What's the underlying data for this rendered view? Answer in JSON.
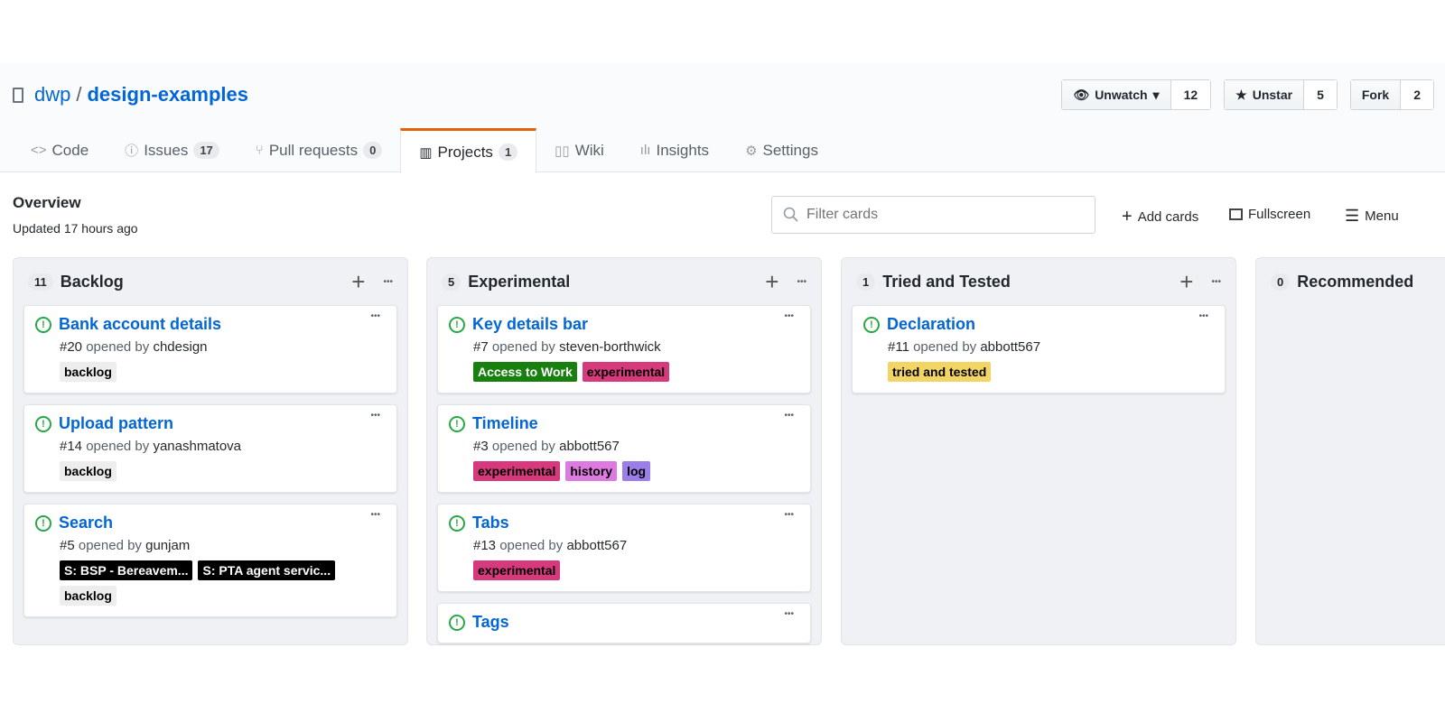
{
  "repo": {
    "owner": "dwp",
    "separator": "/",
    "name": "design-examples"
  },
  "actions": [
    {
      "label": "Unwatch",
      "icon": "eye-icon",
      "caret": true,
      "count": "12"
    },
    {
      "label": "Unstar",
      "icon": "star-icon",
      "count": "5"
    },
    {
      "label": "Fork",
      "count": "2"
    }
  ],
  "tabs": [
    {
      "label": "Code",
      "icon": "code-icon"
    },
    {
      "label": "Issues",
      "icon": "issue-icon",
      "count": "17"
    },
    {
      "label": "Pull requests",
      "icon": "pull-request-icon",
      "count": "0"
    },
    {
      "label": "Projects",
      "icon": "project-icon",
      "count": "1",
      "selected": true
    },
    {
      "label": "Wiki",
      "icon": "book-icon"
    },
    {
      "label": "Insights",
      "icon": "graph-icon"
    },
    {
      "label": "Settings",
      "icon": "gear-icon"
    }
  ],
  "project": {
    "title": "Overview",
    "updated": "Updated 17 hours ago"
  },
  "filter": {
    "placeholder": "Filter cards"
  },
  "toolbar": {
    "add_cards": "Add cards",
    "fullscreen": "Fullscreen",
    "menu": "Menu"
  },
  "colors": {
    "accent": "#e36209",
    "link": "#0366d6",
    "issue_open": "#28a745"
  },
  "columns": [
    {
      "title": "Backlog",
      "count": "11",
      "cards": [
        {
          "title": "Bank account details",
          "number": "#20",
          "opened": "opened by",
          "author": "chdesign",
          "labels": [
            {
              "name": "backlog",
              "bg": "#ededed",
              "fg": "#000"
            }
          ]
        },
        {
          "title": "Upload pattern",
          "number": "#14",
          "opened": "opened by",
          "author": "yanashmatova",
          "labels": [
            {
              "name": "backlog",
              "bg": "#ededed",
              "fg": "#000"
            }
          ]
        },
        {
          "title": "Search",
          "number": "#5",
          "opened": "opened by",
          "author": "gunjam",
          "labels": [
            {
              "name": "S: BSP - Bereavem...",
              "bg": "#000000",
              "fg": "#fff"
            },
            {
              "name": "S: PTA agent servic...",
              "bg": "#000000",
              "fg": "#fff"
            },
            {
              "name": "backlog",
              "bg": "#ededed",
              "fg": "#000"
            }
          ]
        }
      ]
    },
    {
      "title": "Experimental",
      "count": "5",
      "cards": [
        {
          "title": "Key details bar",
          "number": "#7",
          "opened": "opened by",
          "author": "steven-borthwick",
          "labels": [
            {
              "name": "Access to Work",
              "bg": "#18800f",
              "fg": "#fff"
            },
            {
              "name": "experimental",
              "bg": "#d73a7c",
              "fg": "#000"
            }
          ]
        },
        {
          "title": "Timeline",
          "number": "#3",
          "opened": "opened by",
          "author": "abbott567",
          "labels": [
            {
              "name": "experimental",
              "bg": "#d73a7c",
              "fg": "#000"
            },
            {
              "name": "history",
              "bg": "#dd7ae0",
              "fg": "#000"
            },
            {
              "name": "log",
              "bg": "#9c7ee8",
              "fg": "#000"
            }
          ]
        },
        {
          "title": "Tabs",
          "number": "#13",
          "opened": "opened by",
          "author": "abbott567",
          "labels": [
            {
              "name": "experimental",
              "bg": "#d73a7c",
              "fg": "#000"
            }
          ]
        },
        {
          "title": "Tags",
          "number": "",
          "opened": "",
          "author": "",
          "labels": []
        }
      ]
    },
    {
      "title": "Tried and Tested",
      "count": "1",
      "cards": [
        {
          "title": "Declaration",
          "number": "#11",
          "opened": "opened by",
          "author": "abbott567",
          "labels": [
            {
              "name": "tried and tested",
              "bg": "#f2d565",
              "fg": "#000"
            }
          ]
        }
      ]
    },
    {
      "title": "Recommended",
      "count": "0",
      "cards": []
    }
  ]
}
